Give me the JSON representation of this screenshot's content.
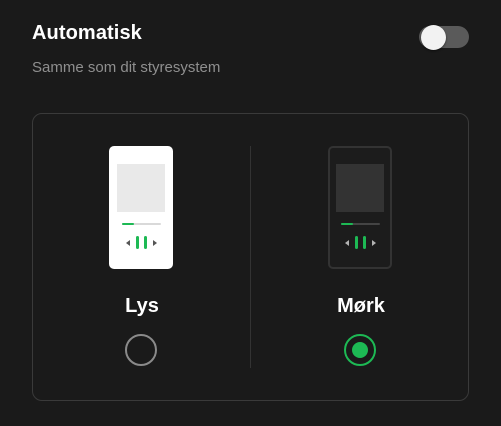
{
  "automatic": {
    "title": "Automatisk",
    "subtitle": "Samme som dit styresystem",
    "toggle_on": false
  },
  "themes": [
    {
      "label": "Lys",
      "selected": false
    },
    {
      "label": "Mørk",
      "selected": true
    }
  ],
  "preview": {
    "progress": 0.3
  },
  "colors": {
    "background": "#1a1a1a",
    "accent": "#1db954",
    "subtitle": "#8f8f8f",
    "card_border": "#3a3a3a"
  }
}
